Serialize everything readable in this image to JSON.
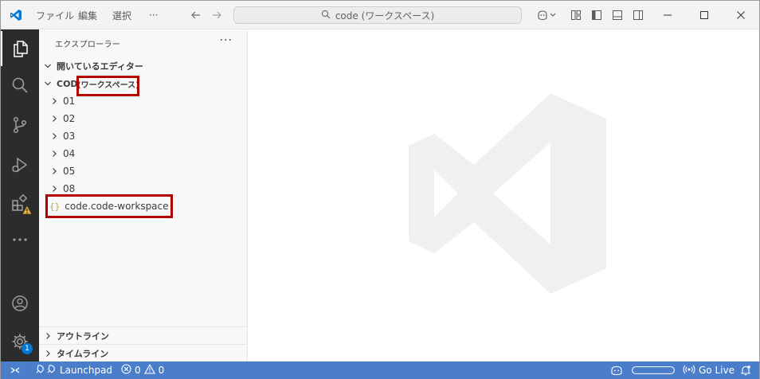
{
  "titlebar": {
    "menu": [
      "ファイル",
      "編集",
      "選択"
    ],
    "more": "···",
    "search_text": "code (ワークスペース)"
  },
  "sidebar": {
    "title": "エクスプローラー",
    "more": "···",
    "open_editors": "開いているエディター",
    "workspace_prefix": "CODE",
    "workspace_suffix": "(ワークスペース)",
    "folders": [
      "01",
      "02",
      "03",
      "04",
      "05",
      "08"
    ],
    "workspace_file": "code.code-workspace",
    "outline": "アウトライン",
    "timeline": "タイムライン"
  },
  "activity": {
    "settings_badge": "1"
  },
  "statusbar": {
    "launchpad": "Launchpad",
    "errors": "0",
    "warnings": "0",
    "go_live": "Go Live"
  },
  "colors": {
    "activitybar": "#2c2c2c",
    "statusbar": "#4a7ecb",
    "highlight": "#b00000",
    "vscode_blue": "#0078d4"
  }
}
